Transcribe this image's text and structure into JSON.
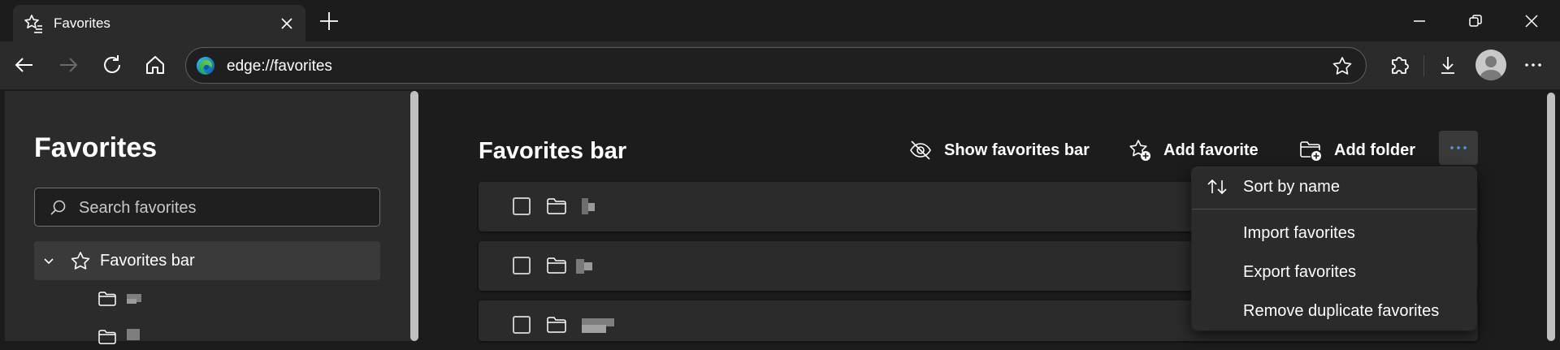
{
  "tab": {
    "title": "Favorites"
  },
  "address_bar": {
    "url": "edge://favorites"
  },
  "sidebar": {
    "title": "Favorites",
    "search": {
      "placeholder": "Search favorites",
      "value": ""
    },
    "tree": {
      "root_label": "Favorites bar",
      "expanded": true,
      "child_count_visible": 2
    }
  },
  "main": {
    "title": "Favorites bar",
    "actions": {
      "show_bar": "Show favorites bar",
      "add_favorite": "Add favorite",
      "add_folder": "Add folder"
    },
    "rows_visible": 3
  },
  "menu": {
    "items": [
      {
        "label": "Sort by name",
        "icon": "sort-icon"
      },
      {
        "label": "Import favorites"
      },
      {
        "label": "Export favorites"
      },
      {
        "label": "Remove duplicate favorites"
      }
    ]
  },
  "colors": {
    "background": "#1c1c1c",
    "surface": "#2b2b2b",
    "accent": "#4f9ae8",
    "text": "#ffffff"
  }
}
